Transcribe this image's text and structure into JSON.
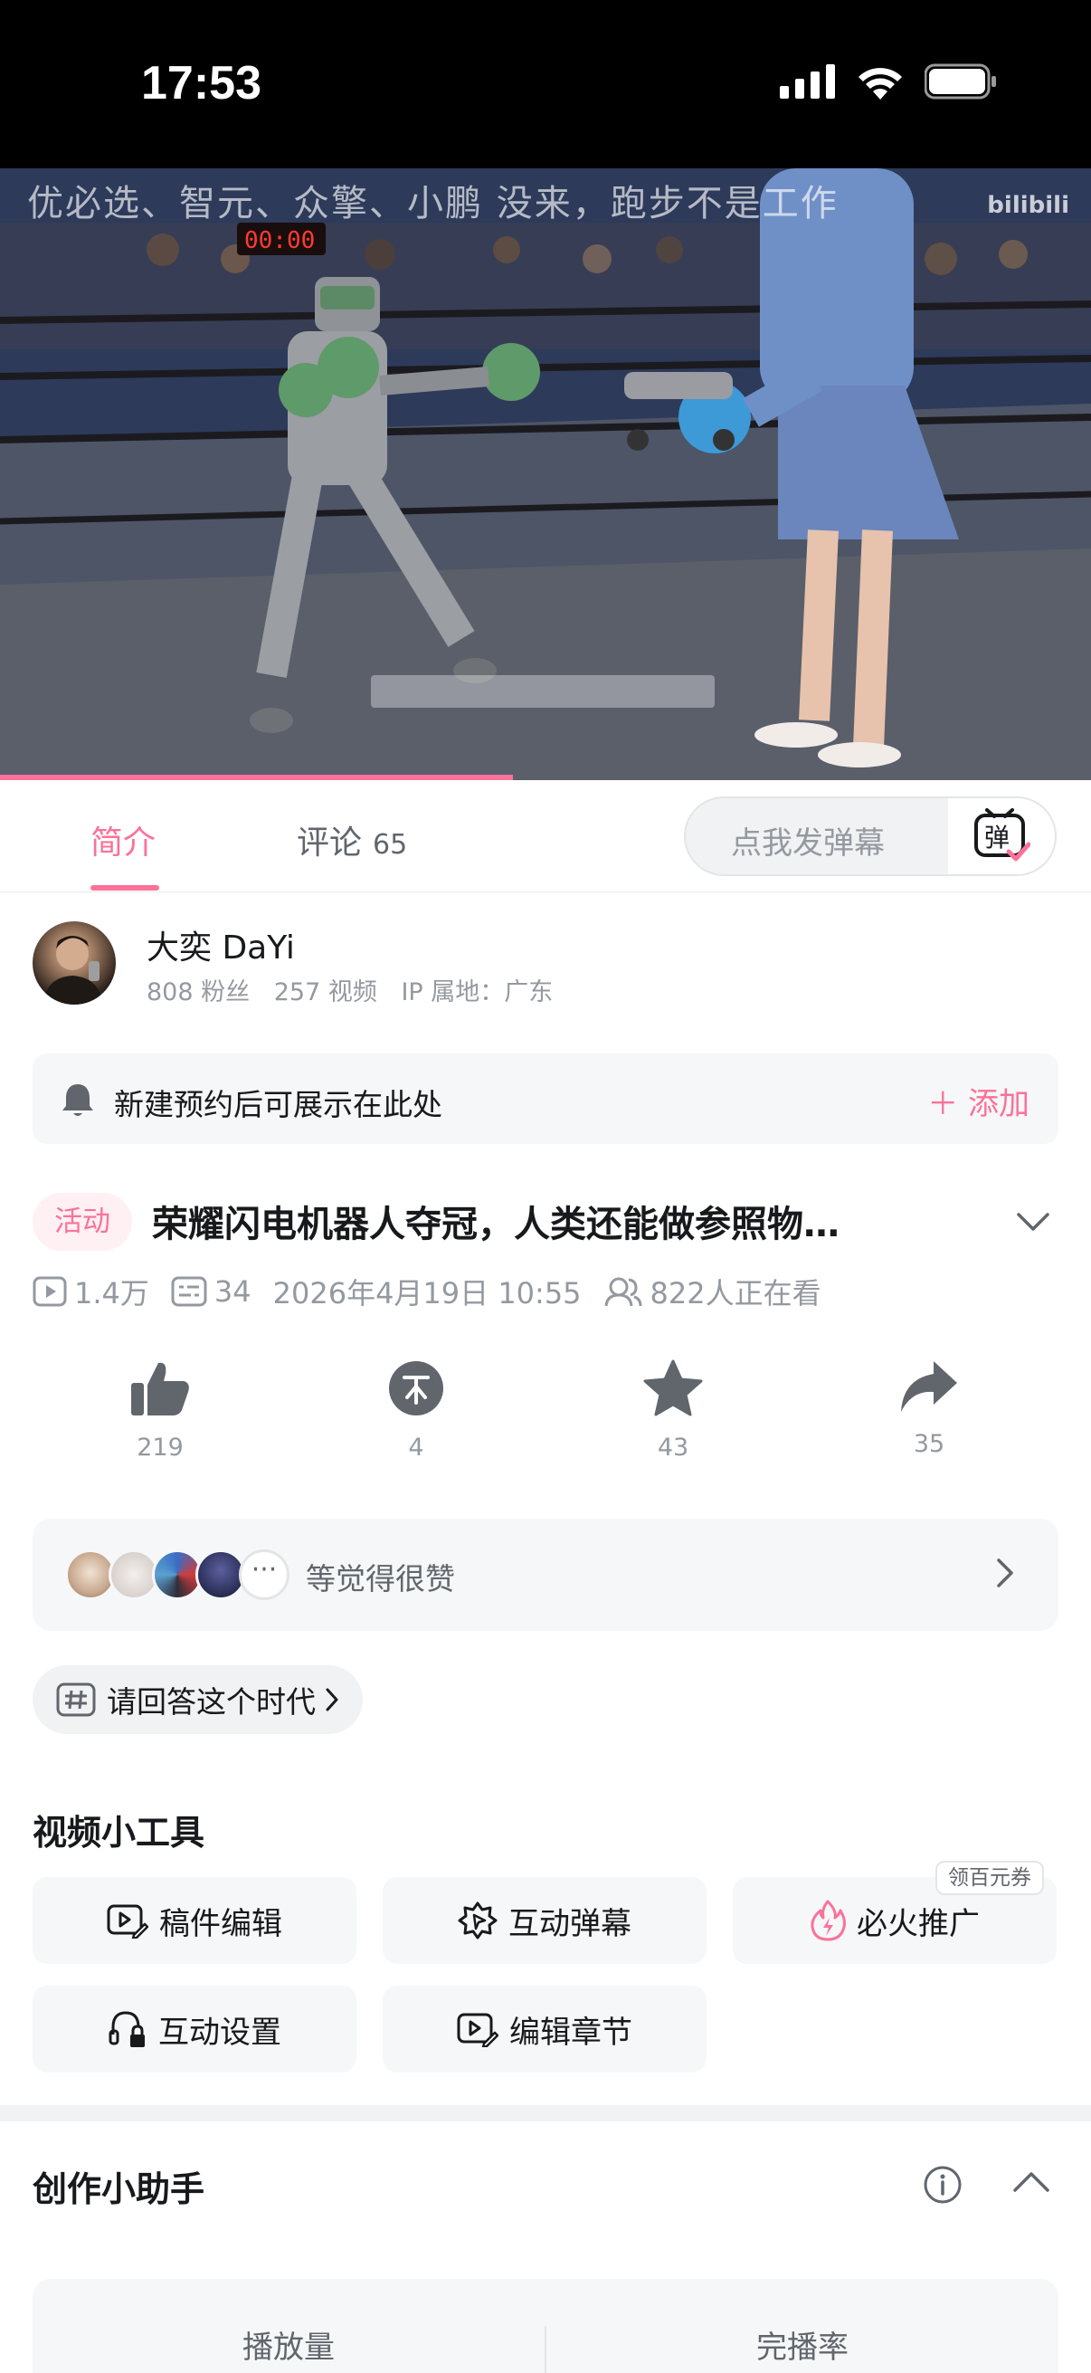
{
  "status_bar": {
    "time": "17:53"
  },
  "video": {
    "danmaku_text": "优必选、智元、众擎、小鹏 没来，跑步不是工作",
    "watermark": "bilibili",
    "progress": 0.47
  },
  "tabs": {
    "intro_label": "简介",
    "comments_label": "评论",
    "comments_count": "65",
    "danmu_placeholder": "点我发弹幕",
    "danmu_toggle_glyph": "弹"
  },
  "author": {
    "name": "大奕 DaYi",
    "fans": "808 粉丝",
    "videos": "257 视频",
    "ip": "IP 属地：广东"
  },
  "reserve": {
    "text": "新建预约后可展示在此处",
    "add_label": "添加"
  },
  "video_info": {
    "badge": "活动",
    "title": "荣耀闪电机器人夺冠，人类还能做参照物…",
    "plays": "1.4万",
    "danmaku_count": "34",
    "date": "2026年4月19日 10:55",
    "watching": "822人正在看"
  },
  "actions": [
    {
      "name": "like",
      "icon": "thumb-up-icon",
      "count": "219"
    },
    {
      "name": "coin",
      "icon": "coin-icon",
      "count": "4"
    },
    {
      "name": "favorite",
      "icon": "star-icon",
      "count": "43"
    },
    {
      "name": "share",
      "icon": "share-icon",
      "count": "35"
    }
  ],
  "liked_by": {
    "text": "等觉得很赞"
  },
  "topic": {
    "label": "请回答这个时代"
  },
  "tools": {
    "title": "视频小工具",
    "items": [
      {
        "label": "稿件编辑",
        "icon": "edit-video-icon"
      },
      {
        "label": "互动弹幕",
        "icon": "interactive-danmaku-icon"
      },
      {
        "label": "必火推广",
        "icon": "flame-icon",
        "coupon": "领百元券"
      },
      {
        "label": "互动设置",
        "icon": "interaction-settings-icon"
      },
      {
        "label": "编辑章节",
        "icon": "chapter-edit-icon"
      }
    ]
  },
  "helper": {
    "title": "创作小助手",
    "metrics": [
      "播放量",
      "完播率"
    ]
  },
  "colors": {
    "accent": "#fb7299",
    "text": "#18191c",
    "secondary": "#9499a0"
  }
}
